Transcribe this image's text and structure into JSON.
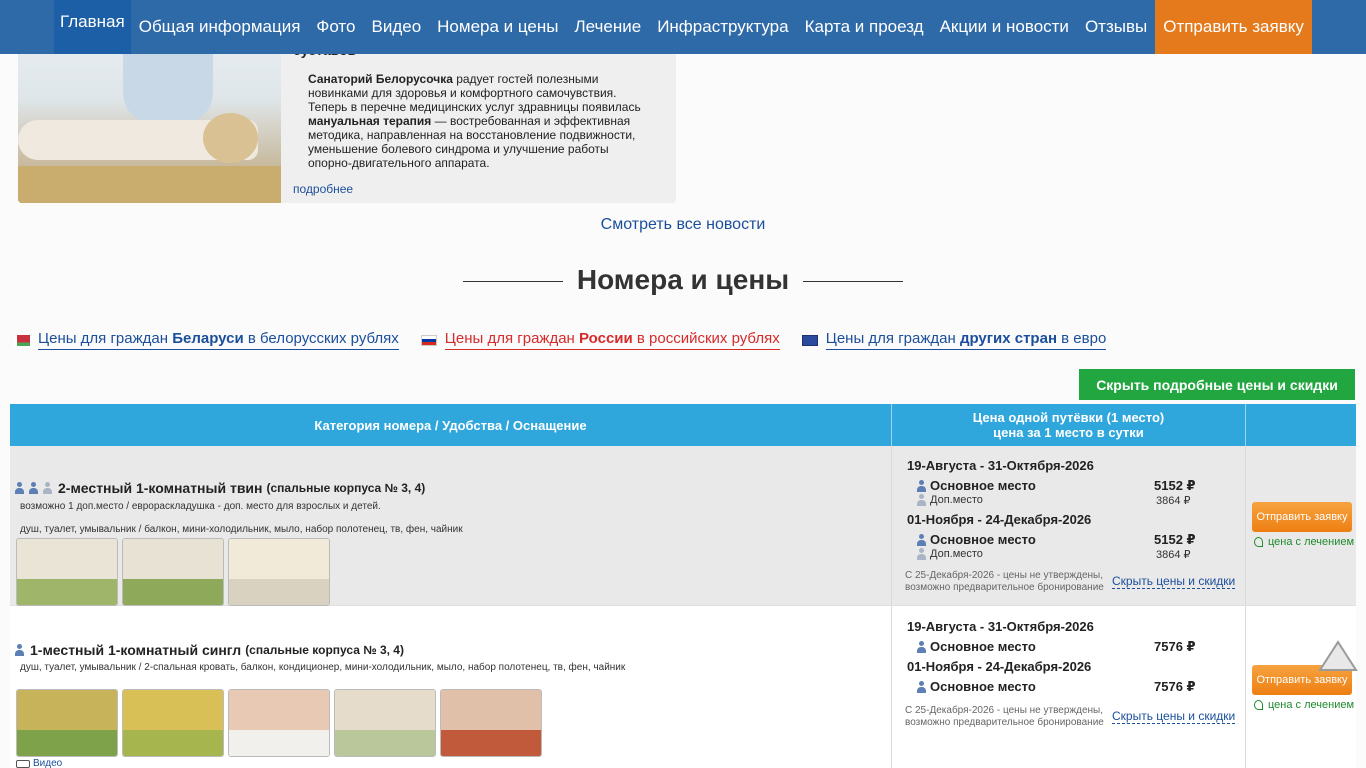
{
  "nav": {
    "items": [
      "Главная",
      "Общая информация",
      "Фото",
      "Видео",
      "Номера и цены",
      "Лечение",
      "Инфраструктура",
      "Карта и проезд",
      "Акции и новости",
      "Отзывы"
    ],
    "cta": "Отправить заявку",
    "colors": {
      "bar": "#2f6aa8",
      "active": "#1d5fa6",
      "cta": "#e57a1c"
    }
  },
  "news": {
    "title_cut": "суставов",
    "body_bold1": "Санаторий Белорусочка",
    "body_text1": " радует гостей полезными новинками для здоровья и комфортного самочувствия. Теперь в перечне медицинских услуг здравницы появилась ",
    "body_bold2": "мануальная терапия",
    "body_text2": " — востребованная и эффективная методика, направленная на восстановление подвижности, уменьшение болевого синдрома и улучшение работы опорно-двигательного аппарата.",
    "more": "подробнее",
    "all_news": "Смотреть все новости"
  },
  "section": {
    "title": "Номера и цены"
  },
  "price_tabs": [
    {
      "pre": "Цены для граждан ",
      "bold": "Беларуси",
      "post": " в белорусских рублях",
      "flag": "by-flag-icon"
    },
    {
      "pre": "Цены для граждан ",
      "bold": "России",
      "post": " в российских рублях",
      "flag": "ru-flag-icon"
    },
    {
      "pre": "Цены для граждан ",
      "bold": "других стран",
      "post": " в евро",
      "flag": "eu-flag-icon"
    }
  ],
  "hide_button": "Скрыть подробные цены и скидки",
  "table": {
    "header_cat": "Категория номера / Удобства / Оснащение",
    "header_price_1": "Цена одной путёвки (1 место)",
    "header_price_2": "цена за 1 место в сутки",
    "header_color": "#2fa6dc",
    "rows": [
      {
        "title": "2-местный 1-комнатный твин",
        "sub": "(спальные корпуса № 3, 4)",
        "note": "возможно 1 доп.место / еврораскладушка - доп. место для взрослых и детей.",
        "amenities": "душ, туалет, умывальник / балкон, мини-холодильник, мыло, набор полотенец, тв, фен, чайник",
        "periods": [
          {
            "label": "19-Августа -  31-Октября-2026",
            "main_label": "Основное место",
            "main_price": "5152 ₽",
            "extra_label": "Доп.место",
            "extra_price": "3864 ₽"
          },
          {
            "label": "01-Ноября -  24-Декабря-2026",
            "main_label": "Основное место",
            "main_price": "5152 ₽",
            "extra_label": "Доп.место",
            "extra_price": "3864 ₽"
          }
        ],
        "footnote": "С  25-Декабря-2026 - цены не утверждены, возможно предварительное бронирование",
        "prices_link": "Скрыть цены и скидки",
        "order": "Отправить заявку",
        "treatment": "цена с лечением"
      },
      {
        "title": "1-местный 1-комнатный сингл",
        "sub": "(спальные корпуса № 3, 4)",
        "amenities": "душ, туалет, умывальник / 2-спальная кровать, балкон, кондиционер, мини-холодильник, мыло, набор полотенец, тв, фен, чайник",
        "video": "Видео",
        "periods": [
          {
            "label": "19-Августа -  31-Октября-2026",
            "main_label": "Основное место",
            "main_price": "7576 ₽"
          },
          {
            "label": "01-Ноября -  24-Декабря-2026",
            "main_label": "Основное место",
            "main_price": "7576 ₽"
          }
        ],
        "footnote": "С  25-Декабря-2026 - цены не утверждены, возможно предварительное бронирование",
        "prices_link": "Скрыть цены и скидки",
        "order": "Отправить заявку",
        "treatment": "цена с лечением"
      }
    ]
  }
}
